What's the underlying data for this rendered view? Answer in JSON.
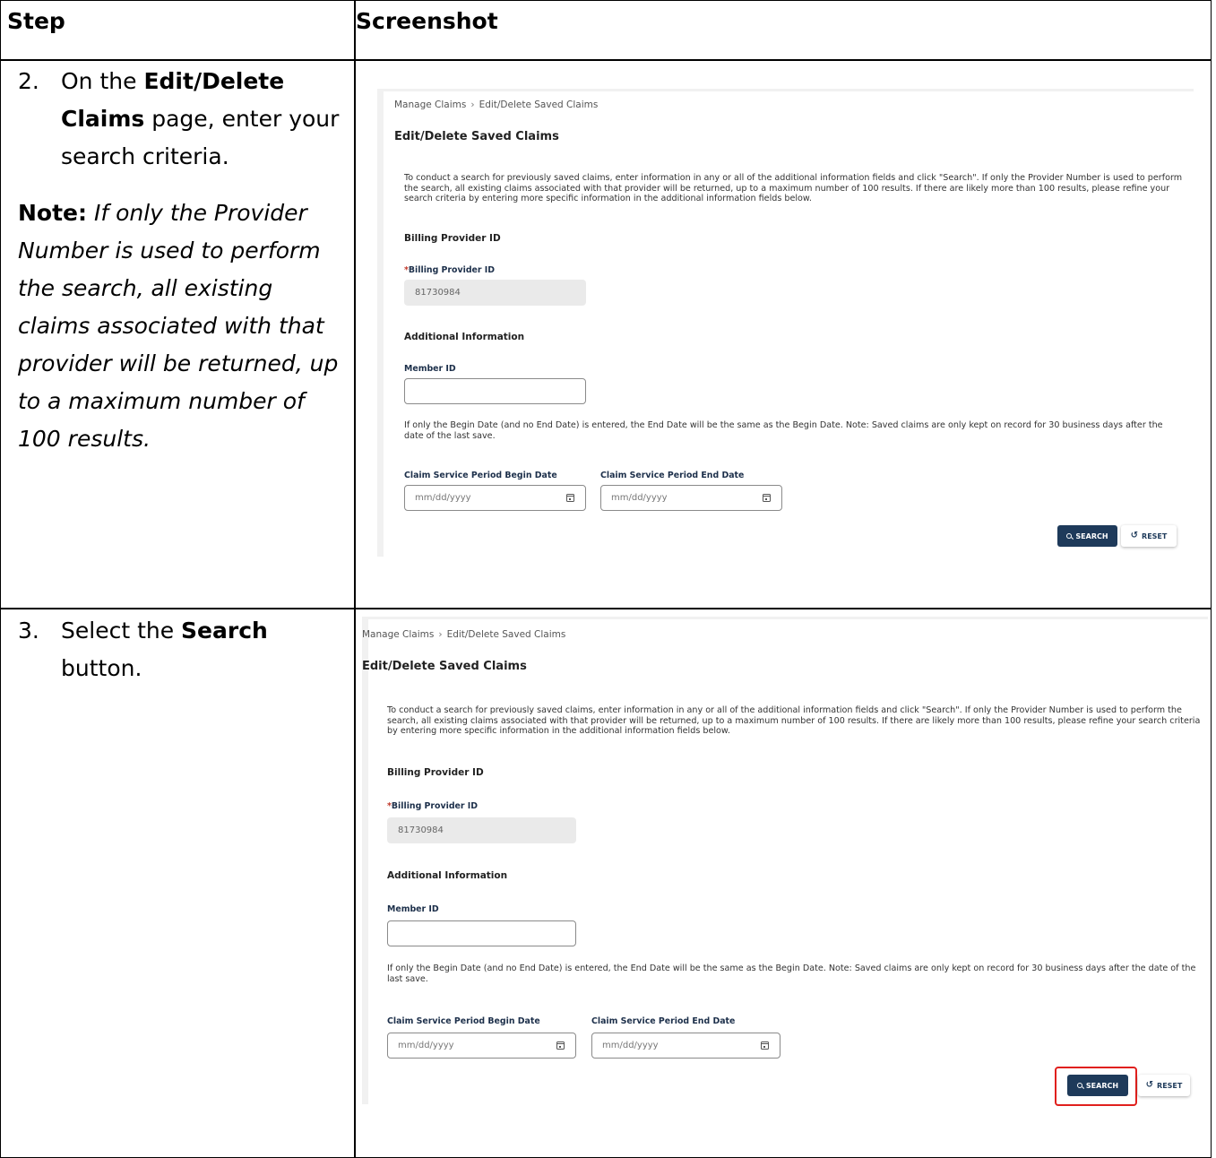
{
  "table": {
    "col_step": "Step",
    "col_screenshot": "Screenshot"
  },
  "step2": {
    "number": "2.",
    "pre": "On the ",
    "bold": "Edit/Delete Claims",
    "post": " page, enter your search criteria.",
    "note_label": "Note",
    "note_text": "If only the Provider Number is used to perform the search, all existing claims associated with that provider will be returned, up to a maximum number of 100 results."
  },
  "step3": {
    "number": "3.",
    "pre": "Select the ",
    "bold": "Search",
    "post": " button."
  },
  "screen": {
    "breadcrumb_root": "Manage Claims",
    "breadcrumb_sep": "›",
    "breadcrumb_current": "Edit/Delete Saved Claims",
    "title": "Edit/Delete Saved Claims",
    "description": "To conduct a search for previously saved claims, enter information in any or all of the additional information fields and click \"Search\". If only the Provider Number is used to perform the search, all existing claims associated with that provider will be returned, up to a maximum number of 100 results. If there are likely more than 100 results, please refine your search criteria by entering more specific information in the additional information fields below.",
    "billing_section": "Billing Provider ID",
    "billing_required_mark": "*",
    "billing_label": "Billing Provider ID",
    "billing_value": "81730984",
    "additional_section": "Additional Information",
    "member_label": "Member ID",
    "member_value": "",
    "date_note": "If only the Begin Date (and no End Date) is entered, the End Date will be the same as the Begin Date. Note: Saved claims are only kept on record for 30 business days after the date of the last save.",
    "begin_label": "Claim Service Period Begin Date",
    "begin_placeholder": "mm/dd/yyyy",
    "end_label": "Claim Service Period End Date",
    "end_placeholder": "mm/dd/yyyy",
    "search_button": "SEARCH",
    "reset_button": "RESET"
  },
  "colors": {
    "primary_button": "#1e3a5a",
    "highlight": "#e0201d",
    "disabled_field": "#eaeaea"
  }
}
